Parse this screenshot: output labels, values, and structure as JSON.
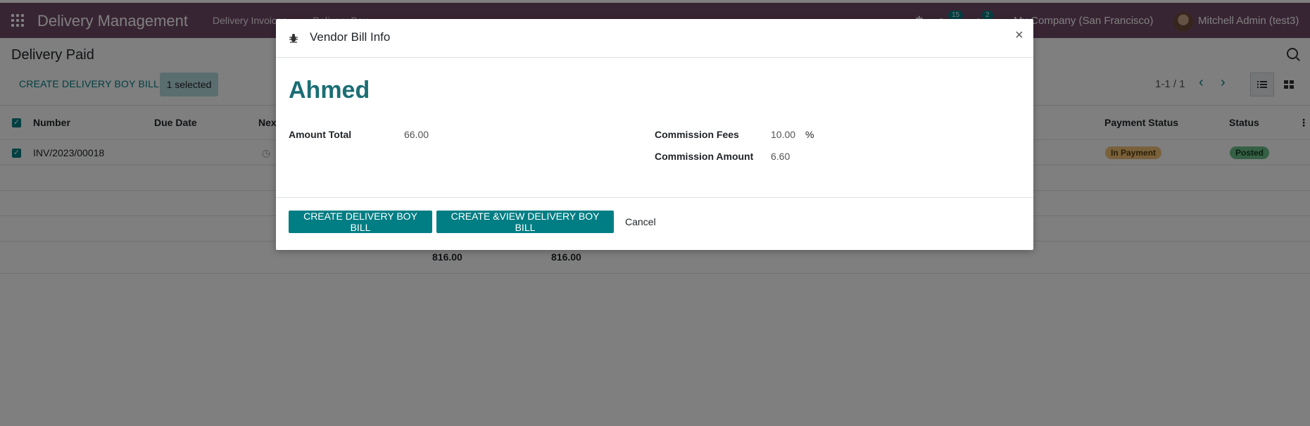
{
  "navbar": {
    "app_name": "Delivery Management",
    "menu": [
      "Delivery Invoices",
      "Delivery Boy"
    ],
    "chat_count": "15",
    "activity_count": "2",
    "company": "My Company (San Francisco)",
    "user": "Mitchell Admin (test3)"
  },
  "control_panel": {
    "breadcrumb": "Delivery Paid",
    "create_button": "CREATE DELIVERY BOY BILL",
    "selected_text": "1 selected",
    "pager": "1-1 / 1"
  },
  "table": {
    "headers": {
      "number": "Number",
      "due_date": "Due Date",
      "next": "Nex",
      "payment_status": "Payment Status",
      "status": "Status"
    },
    "rows": [
      {
        "number": "INV/2023/00018",
        "payment_status": "In Payment",
        "status": "Posted"
      }
    ],
    "totals": [
      "816.00",
      "816.00"
    ]
  },
  "modal": {
    "title": "Vendor Bill Info",
    "record_name": "Ahmed",
    "fields": {
      "amount_total_label": "Amount Total",
      "amount_total_value": "66.00",
      "commission_fees_label": "Commission Fees",
      "commission_fees_value": "10.00",
      "commission_fees_unit": "%",
      "commission_amount_label": "Commission Amount",
      "commission_amount_value": "6.60"
    },
    "buttons": {
      "create": "CREATE DELIVERY BOY BILL",
      "create_view": "CREATE &VIEW DELIVERY BOY BILL",
      "cancel": "Cancel"
    },
    "close_symbol": "×"
  },
  "colors": {
    "navbar": "#714B67",
    "primary": "#017E84",
    "in_payment_pill": "#f2c279",
    "posted_pill": "#6cc18a"
  }
}
